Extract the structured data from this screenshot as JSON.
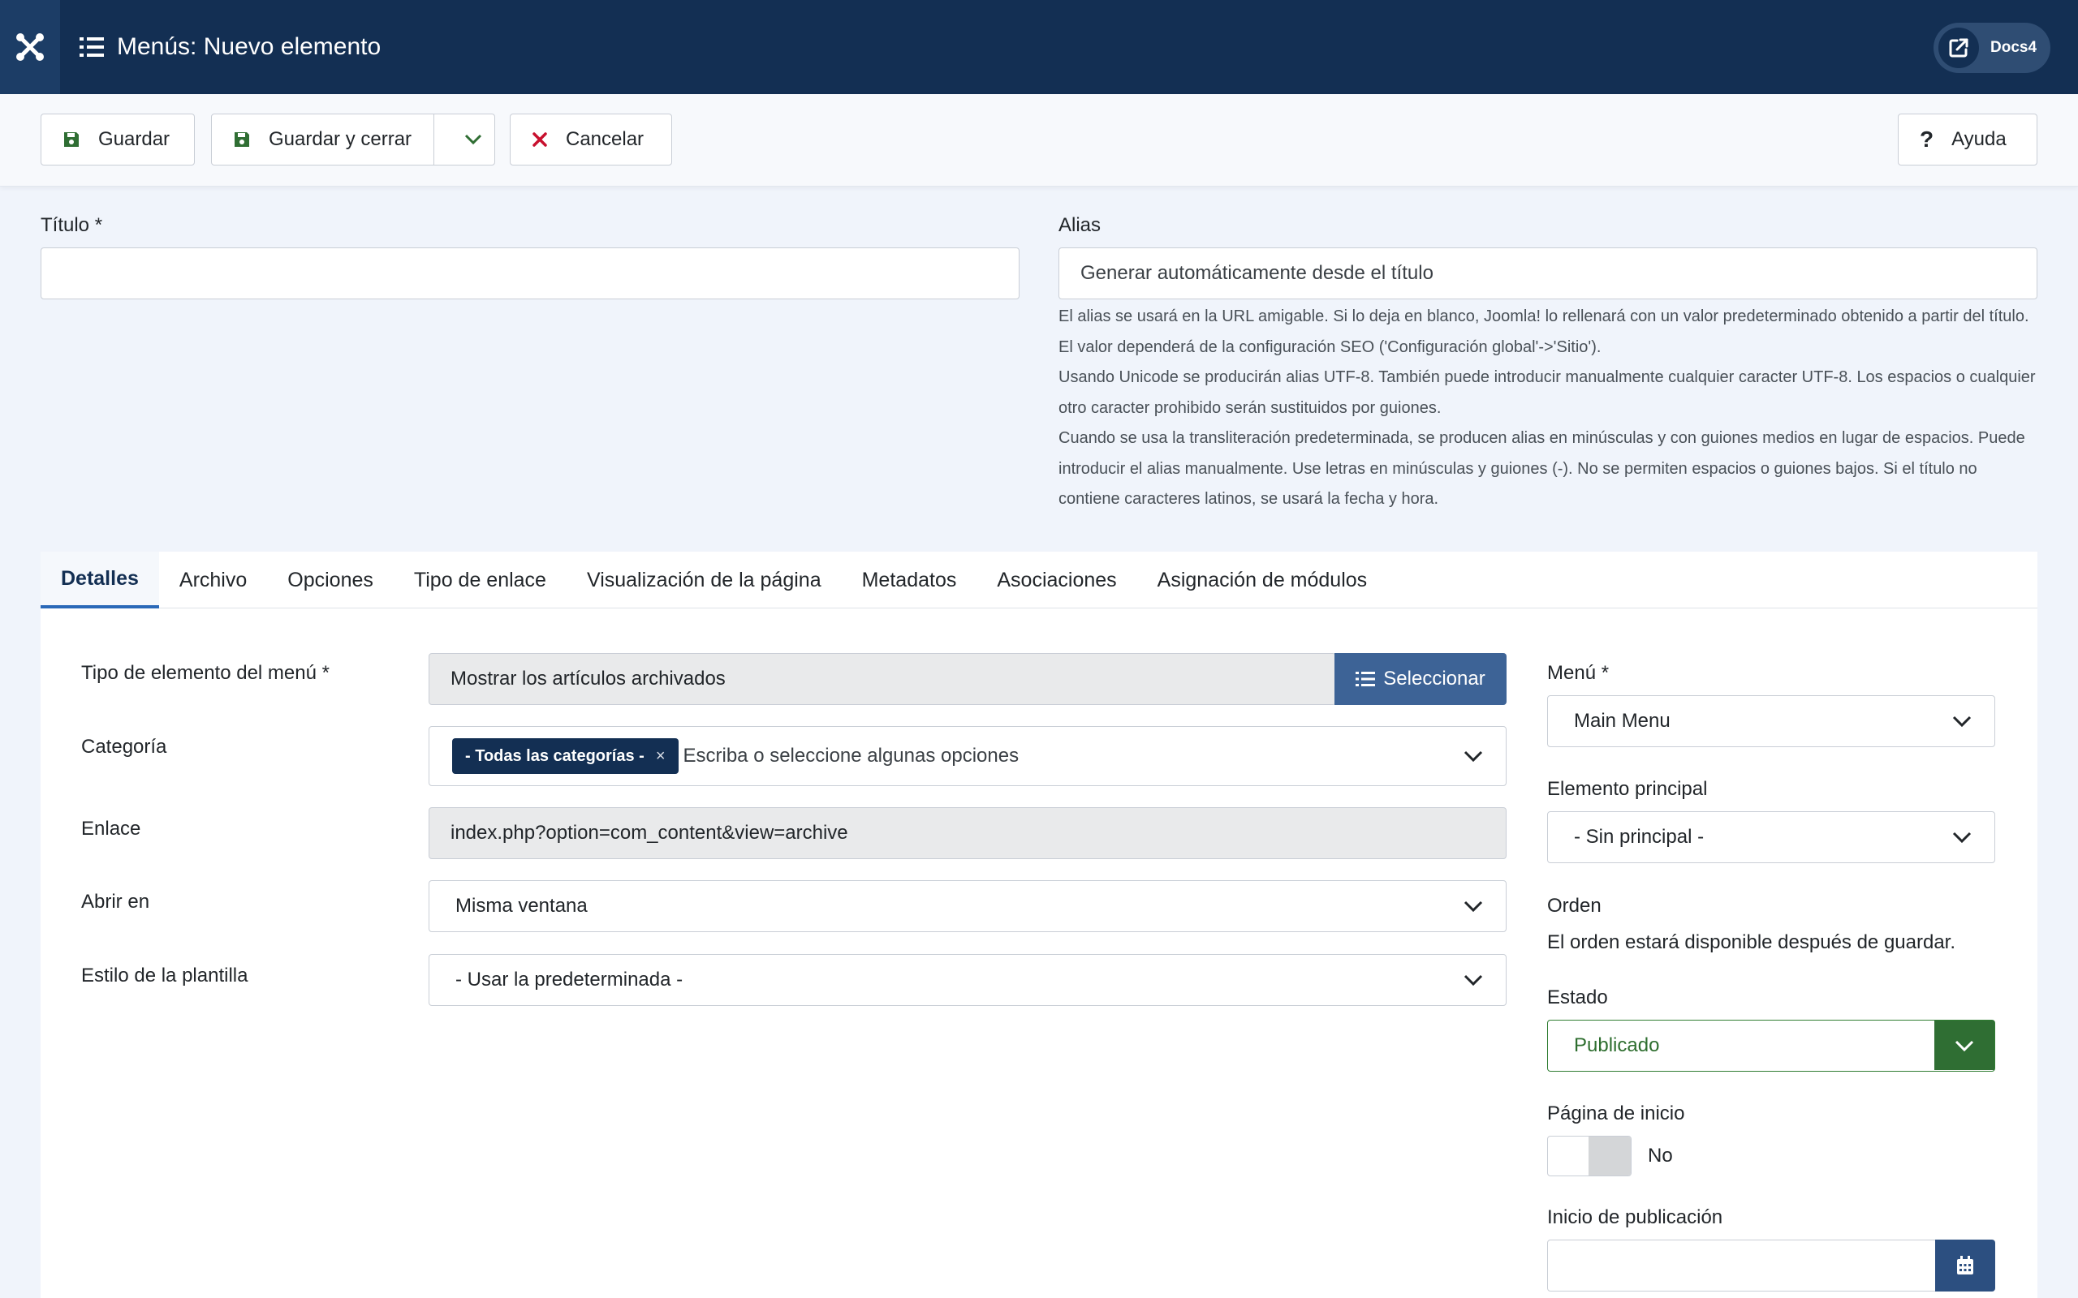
{
  "header": {
    "title": "Menús: Nuevo elemento",
    "docs_label": "Docs4"
  },
  "toolbar": {
    "save_label": "Guardar",
    "save_close_label": "Guardar y cerrar",
    "cancel_label": "Cancelar",
    "help_label": "Ayuda"
  },
  "form": {
    "title_label": "Título *",
    "title_value": "",
    "alias_label": "Alias",
    "alias_placeholder": "Generar automáticamente desde el título",
    "alias_help": [
      "El alias se usará en la URL amigable. Si lo deja en blanco, Joomla! lo rellenará con un valor predeterminado obtenido a partir del título. El valor dependerá de la configuración SEO ('Configuración global'->'Sitio').",
      "Usando Unicode se producirán alias UTF-8. También puede introducir manualmente cualquier caracter UTF-8. Los espacios o cualquier otro caracter prohibido serán sustituidos por guiones.",
      "Cuando se usa la transliteración predeterminada, se producen alias en minúsculas y con guiones medios en lugar de espacios. Puede introducir el alias manualmente. Use letras en minúsculas y guiones (-). No se permiten espacios o guiones bajos. Si el título no contiene caracteres latinos, se usará la fecha y hora."
    ]
  },
  "tabs": [
    {
      "label": "Detalles",
      "active": true
    },
    {
      "label": "Archivo"
    },
    {
      "label": "Opciones"
    },
    {
      "label": "Tipo de enlace"
    },
    {
      "label": "Visualización de la página"
    },
    {
      "label": "Metadatos"
    },
    {
      "label": "Asociaciones"
    },
    {
      "label": "Asignación de módulos"
    }
  ],
  "details": {
    "menu_item_type_label": "Tipo de elemento del menú *",
    "menu_item_type_value": "Mostrar los artículos archivados",
    "select_label": "Seleccionar",
    "category_label": "Categoría",
    "category_tag": "- Todas las categorías -",
    "category_placeholder": "Escriba o seleccione algunas opciones",
    "link_label": "Enlace",
    "link_value": "index.php?option=com_content&view=archive",
    "open_in_label": "Abrir en",
    "open_in_value": "Misma ventana",
    "template_style_label": "Estilo de la plantilla",
    "template_style_value": "- Usar la predeterminada -"
  },
  "sidebar": {
    "menu_label": "Menú *",
    "menu_value": "Main Menu",
    "parent_label": "Elemento principal",
    "parent_value": "- Sin principal -",
    "order_label": "Orden",
    "order_text": "El orden estará disponible después de guardar.",
    "status_label": "Estado",
    "status_value": "Publicado",
    "home_label": "Página de inicio",
    "home_value": "No",
    "publish_start_label": "Inicio de publicación"
  },
  "colors": {
    "header_bg": "#132f53",
    "accent_blue": "#3d6396",
    "status_green": "#2f6e33"
  }
}
